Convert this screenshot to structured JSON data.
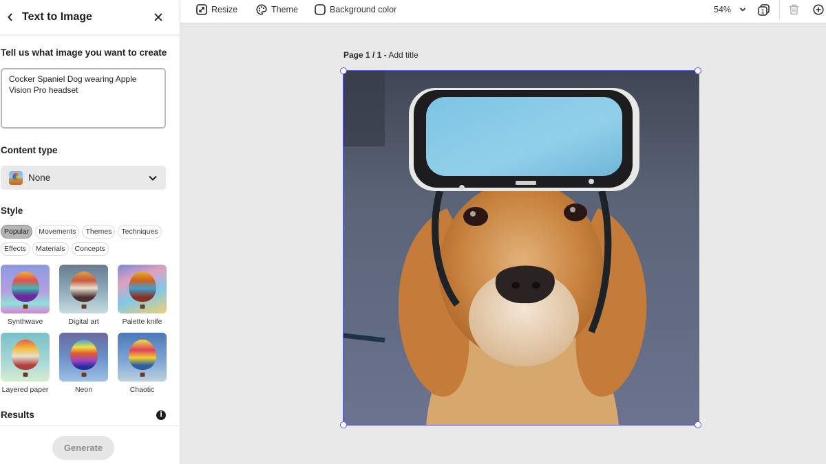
{
  "panel": {
    "title": "Text to Image",
    "back_icon": "chevron-left-icon",
    "close_icon": "close-icon",
    "prompt_label": "Tell us what image you want to create",
    "prompt_value": "Cocker Spaniel Dog wearing Apple Vision Pro headset",
    "content_type_label": "Content type",
    "content_type_value": "None",
    "style_label": "Style",
    "style_tabs": [
      {
        "label": "Popular",
        "active": true
      },
      {
        "label": "Movements",
        "active": false
      },
      {
        "label": "Themes",
        "active": false
      },
      {
        "label": "Techniques",
        "active": false
      },
      {
        "label": "Effects",
        "active": false
      },
      {
        "label": "Materials",
        "active": false
      },
      {
        "label": "Concepts",
        "active": false
      }
    ],
    "styles": [
      {
        "label": "Synthwave"
      },
      {
        "label": "Digital art"
      },
      {
        "label": "Palette knife"
      },
      {
        "label": "Layered paper"
      },
      {
        "label": "Neon"
      },
      {
        "label": "Chaotic"
      }
    ],
    "results_label": "Results",
    "info_icon": "i",
    "generate_label": "Generate"
  },
  "toolbar": {
    "resize_label": "Resize",
    "theme_label": "Theme",
    "background_label": "Background color",
    "zoom_value": "54%",
    "pages_badge": "1"
  },
  "canvas": {
    "page_prefix": "Page 1 / 1 -",
    "page_title_placeholder": "Add title",
    "image_description": "Cocker Spaniel dog wearing a VR headset",
    "selection_color": "#5a5ae6"
  }
}
